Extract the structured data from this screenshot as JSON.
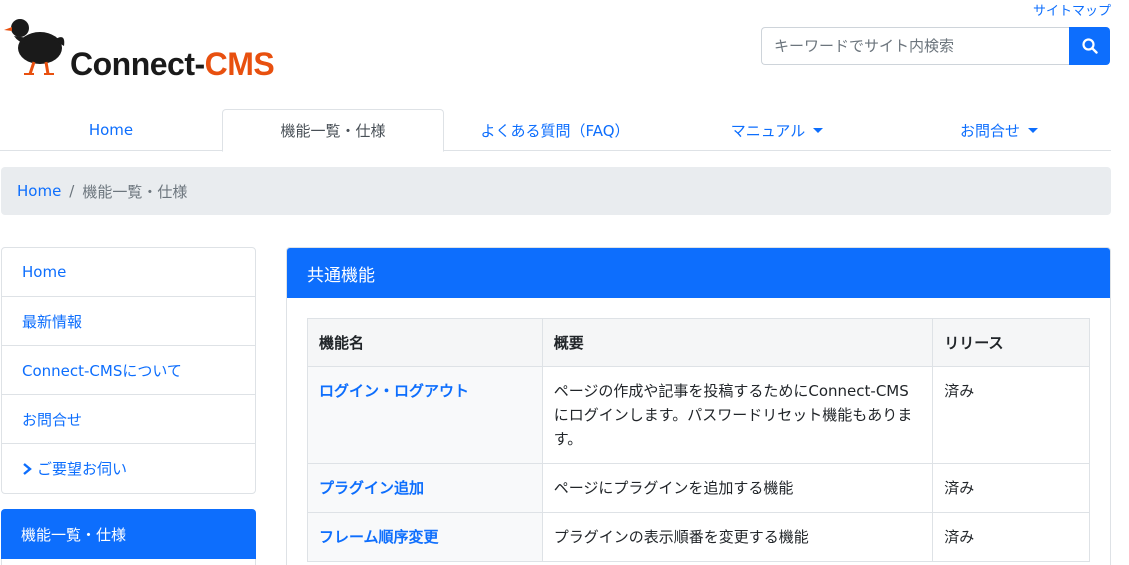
{
  "header": {
    "sitemap_link": "サイトマップ",
    "logo_text_part1": "Connect-",
    "logo_text_part2": "CMS",
    "search": {
      "placeholder": "キーワードでサイト内検索",
      "value": ""
    }
  },
  "nav": {
    "items": [
      {
        "label": "Home",
        "active": false,
        "dropdown": false
      },
      {
        "label": "機能一覧・仕様",
        "active": true,
        "dropdown": false
      },
      {
        "label": "よくある質問（FAQ）",
        "active": false,
        "dropdown": false
      },
      {
        "label": "マニュアル",
        "active": false,
        "dropdown": true
      },
      {
        "label": "お問合せ",
        "active": false,
        "dropdown": true
      }
    ]
  },
  "breadcrumb": {
    "home": "Home",
    "separator": "/",
    "current": "機能一覧・仕様"
  },
  "sidebar": {
    "items": [
      {
        "label": "Home"
      },
      {
        "label": "最新情報"
      },
      {
        "label": "Connect-CMSについて"
      },
      {
        "label": "お問合せ"
      },
      {
        "label": "ご要望お伺い",
        "chevron": "›"
      }
    ],
    "active_label": "機能一覧・仕様"
  },
  "main": {
    "card_title": "共通機能",
    "table": {
      "headers": [
        "機能名",
        "概要",
        "リリース"
      ],
      "rows": [
        {
          "name": "ログイン・ログアウト",
          "summary": "ページの作成や記事を投稿するためにConnect-CMSにログインします。パスワードリセット機能もあります。",
          "release": "済み"
        },
        {
          "name": "プラグイン追加",
          "summary": "ページにプラグインを追加する機能",
          "release": "済み"
        },
        {
          "name": "フレーム順序変更",
          "summary": "プラグインの表示順番を変更する機能",
          "release": "済み"
        }
      ]
    }
  },
  "colors": {
    "primary": "#0d6efd",
    "logo_accent": "#e8500f",
    "breadcrumb_bg": "#e9ecef"
  }
}
